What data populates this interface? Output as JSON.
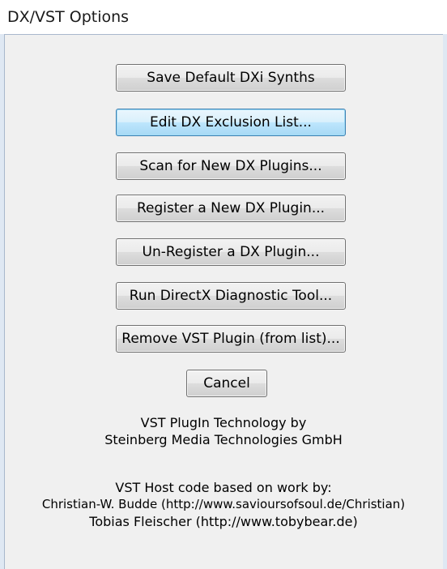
{
  "window": {
    "title": "DX/VST Options"
  },
  "buttons": {
    "save_default": "Save Default DXi Synths",
    "edit_exclusion": "Edit DX Exclusion List...",
    "scan_new": "Scan for New DX Plugins...",
    "register_new": "Register a New DX Plugin...",
    "unregister": "Un-Register a DX Plugin...",
    "run_diagnostic": "Run DirectX Diagnostic Tool...",
    "remove_vst": "Remove VST Plugin (from list)...",
    "cancel": "Cancel"
  },
  "credits": {
    "tech_line1": "VST PlugIn Technology by",
    "tech_line2": "Steinberg Media Technologies GmbH",
    "host_line1": "VST Host code based on work by:",
    "host_line2": "Christian-W. Budde (http://www.savioursofsoul.de/Christian)",
    "host_line3": "Tobias Fleischer (http://www.tobybear.de)"
  },
  "colors": {
    "client_bg": "#f0f0f0",
    "focused_button_border": "#3c7fb1",
    "button_border": "#707070"
  }
}
